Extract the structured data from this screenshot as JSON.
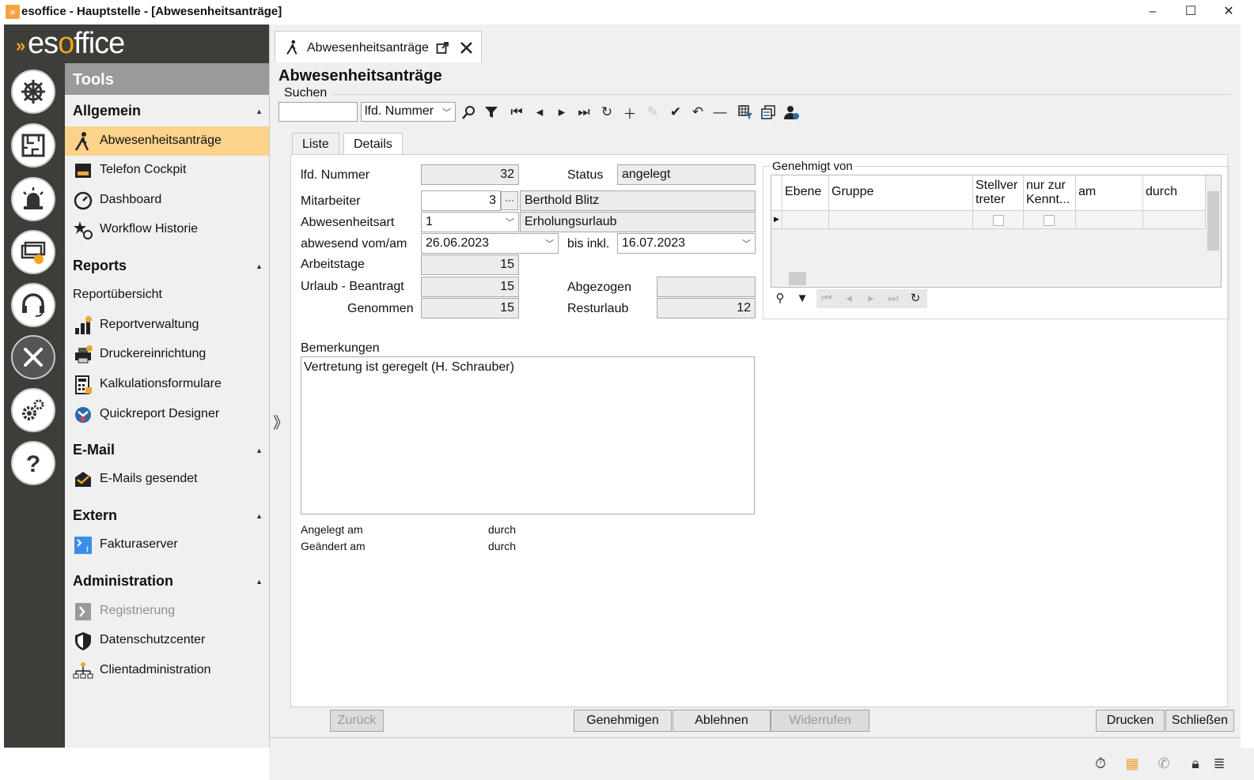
{
  "window": {
    "title": "esoffice - Hauptstelle - [Abwesenheitsanträge]",
    "minimize": "–",
    "maximize": "☐",
    "close": "✕"
  },
  "logo": {
    "pre": "es",
    "accent": "o",
    "post": "ffice"
  },
  "sidebar": {
    "header": "Tools",
    "groups": [
      {
        "title": "Allgemein",
        "items": [
          "Abwesenheitsanträge",
          "Telefon Cockpit",
          "Dashboard",
          "Workflow Historie"
        ]
      },
      {
        "title": "Reports",
        "items": [
          "Reportübersicht",
          "Reportverwaltung",
          "Druckereinrichtung",
          "Kalkulationsformulare",
          "Quickreport Designer"
        ]
      },
      {
        "title": "E-Mail",
        "items": [
          "E-Mails gesendet"
        ]
      },
      {
        "title": "Extern",
        "items": [
          "Fakturaserver"
        ]
      },
      {
        "title": "Administration",
        "items": [
          "Registrierung",
          "Datenschutzcenter",
          "Clientadministration"
        ]
      }
    ]
  },
  "tab": {
    "label": "Abwesenheitsanträge"
  },
  "page": {
    "title": "Abwesenheitsanträge"
  },
  "search": {
    "label": "Suchen",
    "value": "",
    "field": "lfd. Nummer"
  },
  "subtabs": [
    "Liste",
    "Details"
  ],
  "form": {
    "lfd_nummer": {
      "label": "lfd. Nummer",
      "value": "32"
    },
    "status": {
      "label": "Status",
      "value": "angelegt"
    },
    "mitarbeiter": {
      "label": "Mitarbeiter",
      "value": "3",
      "name": "Berthold Blitz",
      "lookup": "···"
    },
    "abwesenheitsart": {
      "label": "Abwesenheitsart",
      "value": "1",
      "name": "Erholungsurlaub"
    },
    "vom": {
      "label": "abwesend vom/am",
      "value": "26.06.2023"
    },
    "bis": {
      "label": "bis inkl.",
      "value": "16.07.2023"
    },
    "arbeitstage": {
      "label": "Arbeitstage",
      "value": "15"
    },
    "beantragt": {
      "label": "Urlaub - Beantragt",
      "value": "15"
    },
    "abgezogen": {
      "label": "Abgezogen",
      "value": ""
    },
    "genommen": {
      "label": "Genommen",
      "value": "15"
    },
    "resturlaub": {
      "label": "Resturlaub",
      "value": "12"
    },
    "bemerkungen": {
      "label": "Bemerkungen",
      "value": "Vertretung ist geregelt (H. Schrauber)"
    },
    "angelegt_am": "Angelegt am",
    "geaendert_am": "Geändert am",
    "durch": "durch"
  },
  "approval": {
    "title": "Genehmigt von",
    "columns": [
      "Ebene",
      "Gruppe",
      "Stellvertreter",
      "nur zur Kenntnis",
      "am",
      "durch"
    ],
    "column_labels": {
      "ebene": "Ebene",
      "gruppe": "Gruppe",
      "stell1": "Stellver",
      "stell2": "treter",
      "kennt1": "nur zur",
      "kennt2": "Kennt...",
      "am": "am",
      "durch": "durch"
    }
  },
  "buttons": {
    "zurueck": "Zurück",
    "genehmigen": "Genehmigen",
    "ablehnen": "Ablehnen",
    "widerrufen": "Widerrufen",
    "drucken": "Drucken",
    "schliessen": "Schließen"
  },
  "colors": {
    "accent": "#f5a31a",
    "active_item": "#fdd28a",
    "rail": "#3d3d3a"
  }
}
